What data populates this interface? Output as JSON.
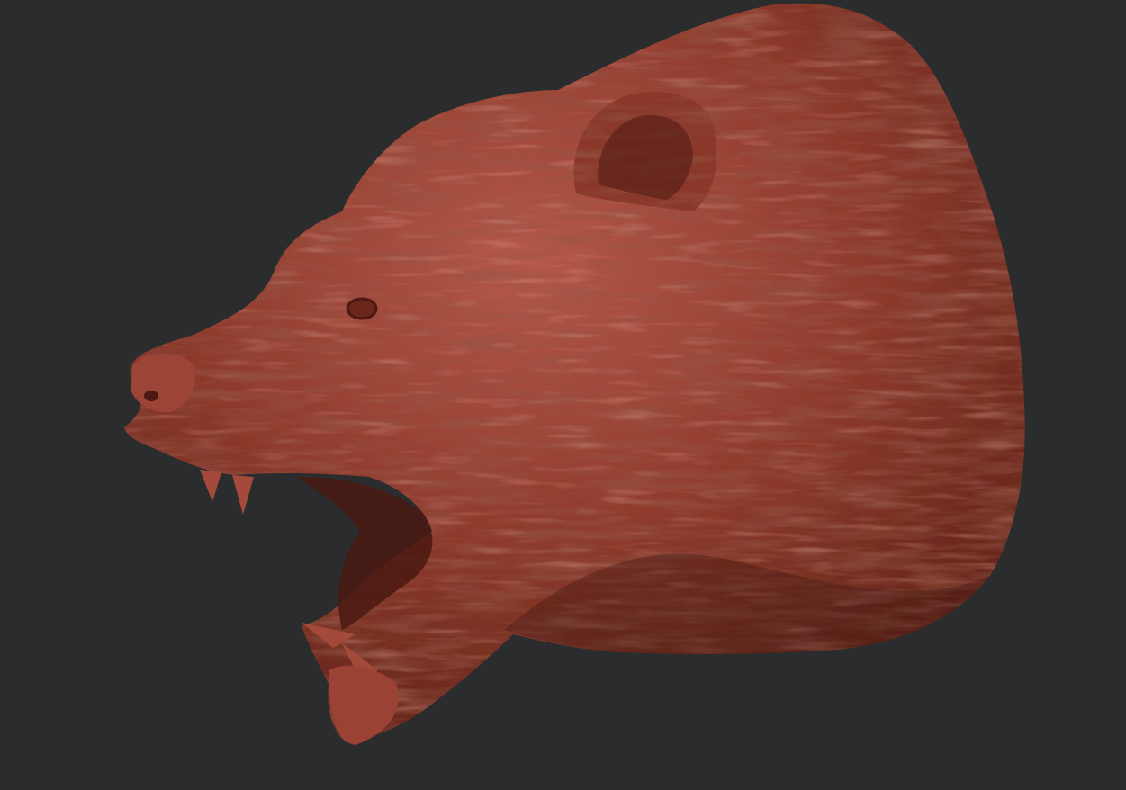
{
  "colors": {
    "background": "#2b2c2e",
    "clay_base": "#8e3b2d",
    "clay_highlight": "#c0624e",
    "clay_shadow": "#4a1911"
  }
}
